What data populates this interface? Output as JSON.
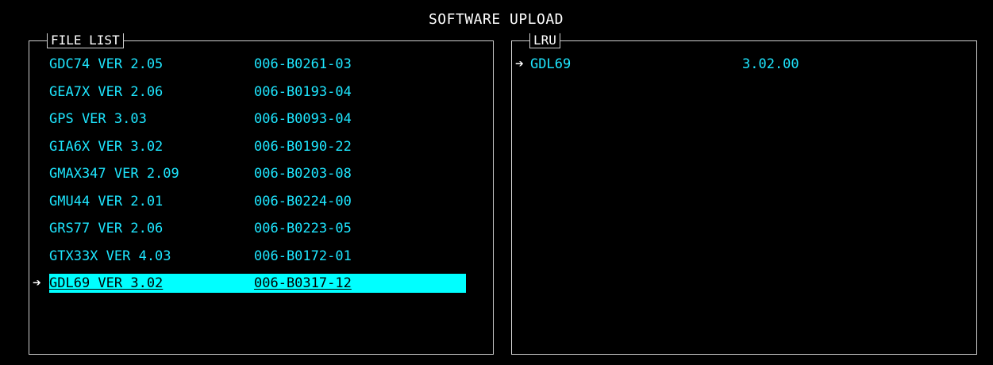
{
  "title": "SOFTWARE UPLOAD",
  "file_list": {
    "label": "FILE LIST",
    "cursor_symbol": "➔",
    "items": [
      {
        "name": "GDC74 VER 2.05",
        "part": "006-B0261-03",
        "selected": false
      },
      {
        "name": "GEA7X VER 2.06",
        "part": "006-B0193-04",
        "selected": false
      },
      {
        "name": "GPS VER 3.03",
        "part": "006-B0093-04",
        "selected": false
      },
      {
        "name": "GIA6X VER 3.02",
        "part": "006-B0190-22",
        "selected": false
      },
      {
        "name": "GMAX347 VER 2.09",
        "part": "006-B0203-08",
        "selected": false
      },
      {
        "name": "GMU44 VER 2.01",
        "part": "006-B0224-00",
        "selected": false
      },
      {
        "name": "GRS77 VER 2.06",
        "part": "006-B0223-05",
        "selected": false
      },
      {
        "name": "GTX33X VER 4.03",
        "part": "006-B0172-01",
        "selected": false
      },
      {
        "name": "GDL69 VER 3.02",
        "part": "006-B0317-12",
        "selected": true
      }
    ]
  },
  "lru": {
    "label": "LRU",
    "cursor_symbol": "➔",
    "items": [
      {
        "name": "GDL69",
        "version": "3.02.00"
      }
    ]
  },
  "colors": {
    "background": "#000000",
    "text_primary": "#1ee6ff",
    "highlight": "#00ffff",
    "border": "#d0d0d0",
    "title_text": "#ffffff"
  }
}
